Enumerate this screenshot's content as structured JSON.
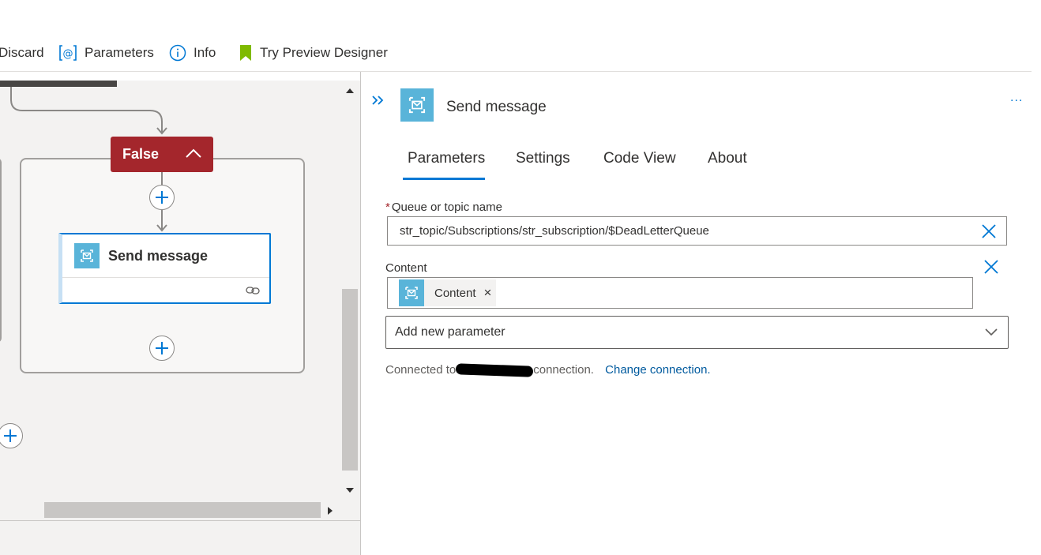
{
  "toolbar": {
    "discard_label": "Discard",
    "parameters_label": "Parameters",
    "info_label": "Info",
    "preview_label": "Try Preview Designer"
  },
  "canvas": {
    "condition_label": "False",
    "card": {
      "title": "Send message"
    }
  },
  "panel": {
    "title": "Send message",
    "more_label": "...",
    "tabs": [
      {
        "label": "Parameters",
        "active": true
      },
      {
        "label": "Settings",
        "active": false
      },
      {
        "label": "Code View",
        "active": false
      },
      {
        "label": "About",
        "active": false
      }
    ],
    "queue_field": {
      "required_mark": "*",
      "label": "Queue or topic name",
      "value": "str_topic/Subscriptions/str_subscription/$DeadLetterQueue"
    },
    "content_field": {
      "label": "Content",
      "token_label": "Content",
      "token_remove": "×"
    },
    "add_parameter": {
      "placeholder": "Add new parameter"
    },
    "connection": {
      "prefix": "Connected to",
      "suffix": "connection.",
      "change_link": "Change connection."
    }
  },
  "colors": {
    "accent": "#0078d4",
    "false_header": "#a4262c",
    "service_icon": "#59b4d9",
    "preview_icon": "#7fba00",
    "link": "#005a9e"
  },
  "icons": {
    "parameters": "at-brackets-icon",
    "info": "info-circle-icon",
    "preview": "bookmark-icon",
    "collapse": "double-chevron-right-icon",
    "service": "service-bus-icon",
    "clear": "close-icon",
    "dropdown": "chevron-down-icon",
    "link": "link-icon",
    "add": "plus-icon"
  }
}
